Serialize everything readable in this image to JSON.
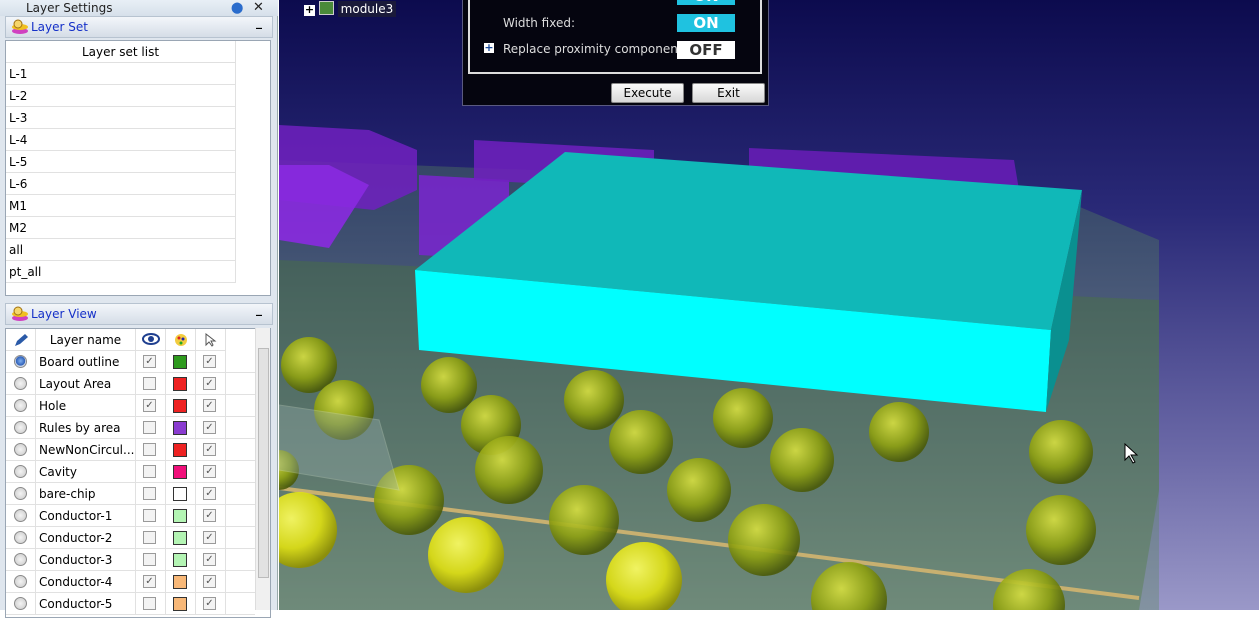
{
  "panel": {
    "title": "Layer Settings"
  },
  "layer_set": {
    "header": "Layer Set",
    "column": "Layer set list",
    "items": [
      "L-1",
      "L-2",
      "L-3",
      "L-4",
      "L-5",
      "L-6",
      "M1",
      "M2",
      "all",
      "pt_all"
    ]
  },
  "layer_view": {
    "header": "Layer View",
    "column": "Layer name",
    "rows": [
      {
        "name": "Board outline",
        "active": true,
        "visible": true,
        "color": "#2e9a1e",
        "selectable": true
      },
      {
        "name": "Layout Area",
        "active": false,
        "visible": false,
        "color": "#ee2222",
        "selectable": true
      },
      {
        "name": "Hole",
        "active": false,
        "visible": true,
        "color": "#ee2222",
        "selectable": true
      },
      {
        "name": "Rules by area",
        "active": false,
        "visible": false,
        "color": "#8a3cd0",
        "selectable": true
      },
      {
        "name": "NewNonCircul...",
        "active": false,
        "visible": false,
        "color": "#ee2222",
        "selectable": true
      },
      {
        "name": "Cavity",
        "active": false,
        "visible": false,
        "color": "#f0107a",
        "selectable": true
      },
      {
        "name": "bare-chip",
        "active": false,
        "visible": false,
        "color": "#ffffff",
        "selectable": true
      },
      {
        "name": "Conductor-1",
        "active": false,
        "visible": false,
        "color": "#b4f5b4",
        "selectable": true
      },
      {
        "name": "Conductor-2",
        "active": false,
        "visible": false,
        "color": "#b4f5b4",
        "selectable": true
      },
      {
        "name": "Conductor-3",
        "active": false,
        "visible": false,
        "color": "#b4f5b4",
        "selectable": true
      },
      {
        "name": "Conductor-4",
        "active": false,
        "visible": true,
        "color": "#f8b878",
        "selectable": true
      },
      {
        "name": "Conductor-5",
        "active": false,
        "visible": false,
        "color": "#f8b878",
        "selectable": true
      }
    ]
  },
  "tree": {
    "node": "module3"
  },
  "dialog": {
    "top_toggle": "ON",
    "width_fixed_label": "Width fixed:",
    "width_fixed": "ON",
    "replace_label": "Replace proximity component:",
    "replace": "OFF",
    "execute": "Execute",
    "exit": "Exit"
  }
}
